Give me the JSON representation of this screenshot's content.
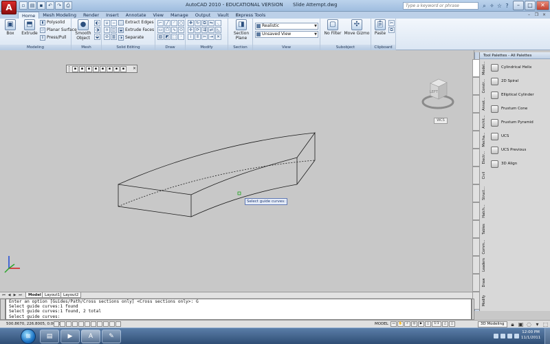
{
  "app": {
    "logo_letter": "A",
    "title_app": "AutoCAD 2010 - EDUCATIONAL VERSION",
    "title_doc": "Slide Attempt.dwg",
    "search_placeholder": "Type a keyword or phrase"
  },
  "window_buttons": [
    "–",
    "□",
    "✕"
  ],
  "qat_icons": [
    "new-icon",
    "open-icon",
    "save-icon",
    "undo-icon",
    "redo-icon",
    "print-icon"
  ],
  "tabs": [
    "Home",
    "Mesh Modeling",
    "Render",
    "Insert",
    "Annotate",
    "View",
    "Manage",
    "Output",
    "Vault",
    "Express Tools"
  ],
  "active_tab": "Home",
  "ribbon": {
    "modeling": {
      "title": "Modeling",
      "box": "Box",
      "extrude": "Extrude",
      "polysolid": "Polysolid",
      "planar_surface": "Planar Surface",
      "presspull": "Press/Pull"
    },
    "mesh": {
      "title": "Mesh",
      "smooth_object_1": "Smooth",
      "smooth_object_2": "Object"
    },
    "solid_editing": {
      "title": "Solid Editing",
      "extract_edges": "Extract Edges",
      "extrude_faces": "Extrude Faces",
      "separate": "Separate"
    },
    "draw": {
      "title": "Draw"
    },
    "modify": {
      "title": "Modify"
    },
    "section": {
      "title": "Section",
      "section_plane_1": "Section",
      "section_plane_2": "Plane"
    },
    "view": {
      "title": "View",
      "visual_style": "Realistic",
      "named_view": "Unsaved View"
    },
    "subobject": {
      "title": "Subobject",
      "no_filter": "No Filter",
      "move_gizmo": "Move Gizmo"
    },
    "clipboard": {
      "title": "Clipboard",
      "paste": "Paste"
    }
  },
  "viewport": {
    "tooltip": "Select guide curves:",
    "viewcube_face": "LEFT",
    "wcs": "WCS"
  },
  "layout_tabs": [
    "Model",
    "Layout1",
    "Layout2"
  ],
  "active_layout": "Model",
  "palette": {
    "title": "Tool Palettes - All Palettes",
    "tools": [
      "Cylindrical Helix",
      "2D Spiral",
      "Elliptical Cylinder",
      "Frustum Cone",
      "Frustum Pyramid",
      "UCS",
      "UCS Previous",
      "3D Align"
    ],
    "side_tabs": [
      "Model...",
      "Constr...",
      "Annot...",
      "Archit...",
      "Mecha...",
      "Electr...",
      "Civil",
      "Struct...",
      "Hatch...",
      "Tables",
      "Comm...",
      "Leaders",
      "Draw",
      "Modify"
    ],
    "active_side_tab": "Model..."
  },
  "command_lines": [
    "Enter an option [Guides/Path/Cross sections only] <Cross sections only>: G",
    "Select guide curves:1 found",
    "Select guide curves:1 found, 2 total",
    "Select guide curves:"
  ],
  "status": {
    "coords": "500.8670, 226.8005, 0.0000",
    "model": "MODEL",
    "scale": "1:1",
    "workspace": "3D Modeling"
  },
  "taskbar": {
    "time": "12:00 PM",
    "date": "11/1/2011"
  }
}
